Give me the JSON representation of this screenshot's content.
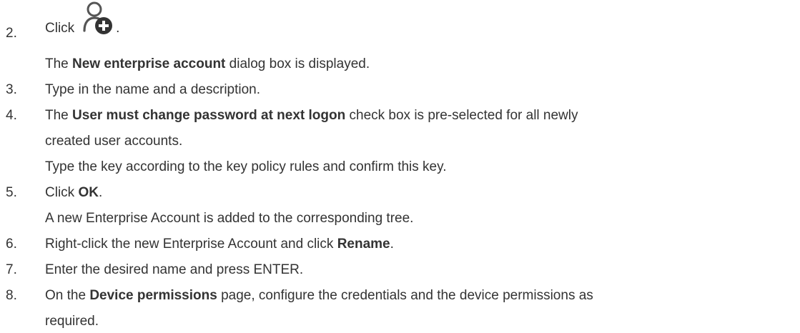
{
  "steps": [
    {
      "number": "2.",
      "lines": [
        {
          "parts": [
            {
              "t": "Click",
              "b": false
            }
          ],
          "icon": "add-user-icon",
          "suffix": "."
        },
        {
          "parts": [
            {
              "t": "The ",
              "b": false
            },
            {
              "t": "New enterprise account",
              "b": true
            },
            {
              "t": " dialog box is displayed.",
              "b": false
            }
          ]
        }
      ]
    },
    {
      "number": "3.",
      "lines": [
        {
          "parts": [
            {
              "t": "Type in the name and a description.",
              "b": false
            }
          ]
        }
      ]
    },
    {
      "number": "4.",
      "lines": [
        {
          "parts": [
            {
              "t": "The ",
              "b": false
            },
            {
              "t": "User must change password at next logon",
              "b": true
            },
            {
              "t": " check box is pre-selected for all newly",
              "b": false
            }
          ]
        },
        {
          "parts": [
            {
              "t": "created user accounts.",
              "b": false
            }
          ]
        },
        {
          "parts": [
            {
              "t": "Type the key according to the key policy rules and confirm this key.",
              "b": false
            }
          ]
        }
      ]
    },
    {
      "number": "5.",
      "lines": [
        {
          "parts": [
            {
              "t": "Click ",
              "b": false
            },
            {
              "t": "OK",
              "b": true
            },
            {
              "t": ".",
              "b": false
            }
          ]
        },
        {
          "parts": [
            {
              "t": "A new Enterprise Account is added to the corresponding tree.",
              "b": false
            }
          ]
        }
      ]
    },
    {
      "number": "6.",
      "lines": [
        {
          "parts": [
            {
              "t": "Right-click the new Enterprise Account and click ",
              "b": false
            },
            {
              "t": "Rename",
              "b": true
            },
            {
              "t": ".",
              "b": false
            }
          ]
        }
      ]
    },
    {
      "number": "7.",
      "lines": [
        {
          "parts": [
            {
              "t": "Enter the desired name and press ENTER.",
              "b": false
            }
          ]
        }
      ]
    },
    {
      "number": "8.",
      "lines": [
        {
          "parts": [
            {
              "t": "On the ",
              "b": false
            },
            {
              "t": "Device permissions",
              "b": true
            },
            {
              "t": " page, configure the credentials and the device permissions as",
              "b": false
            }
          ]
        },
        {
          "parts": [
            {
              "t": "required.",
              "b": false
            }
          ]
        }
      ]
    }
  ]
}
